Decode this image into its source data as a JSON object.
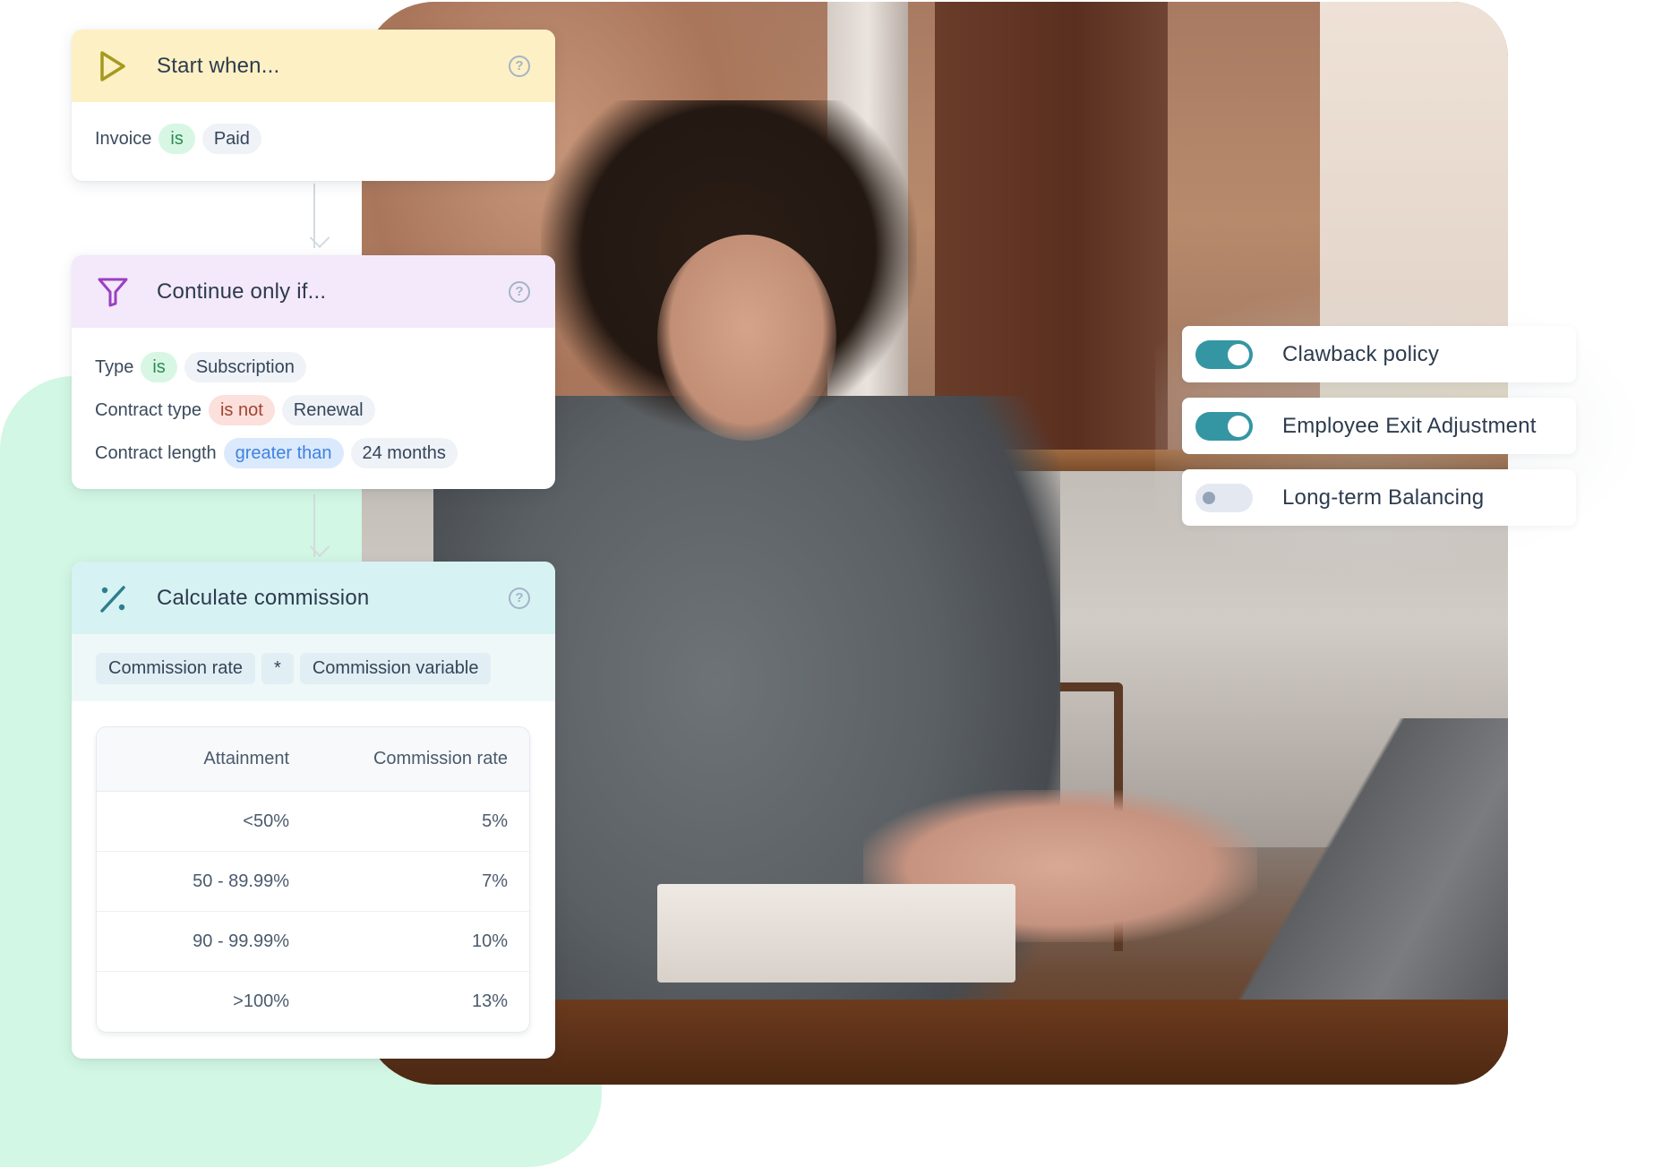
{
  "workflow": {
    "steps": [
      {
        "title": "Start when...",
        "icon": "play-icon",
        "help_icon": "question-circle-icon",
        "conditions": [
          {
            "field": "Invoice",
            "operator": "is",
            "value": "Paid"
          }
        ]
      },
      {
        "title": "Continue only if...",
        "icon": "filter-icon",
        "help_icon": "question-circle-icon",
        "conditions": [
          {
            "field": "Type",
            "operator": "is",
            "value": "Subscription"
          },
          {
            "field": "Contract type",
            "operator": "is not",
            "value": "Renewal"
          },
          {
            "field": "Contract length",
            "operator": "greater than",
            "value": "24 months"
          }
        ]
      },
      {
        "title": "Calculate commission",
        "icon": "percent-icon",
        "help_icon": "question-circle-icon",
        "formula": [
          "Commission rate",
          "*",
          "Commission variable"
        ],
        "table": {
          "headers": [
            "Attainment",
            "Commission rate"
          ],
          "rows": [
            [
              "<50%",
              "5%"
            ],
            [
              "50 - 89.99%",
              "7%"
            ],
            [
              "90 - 99.99%",
              "10%"
            ],
            [
              ">100%",
              "13%"
            ]
          ]
        }
      }
    ],
    "help_glyph": "?"
  },
  "toggles": [
    {
      "label": "Clawback policy",
      "enabled": true
    },
    {
      "label": "Employee Exit Adjustment",
      "enabled": true
    },
    {
      "label": "Long-term Balancing",
      "enabled": false
    }
  ],
  "colors": {
    "toggle_on": "#3596a3",
    "toggle_off": "#e4e9f1",
    "start_header": "#fdf0c4",
    "filter_header": "#f4e8fb",
    "calc_header": "#d7f2f3",
    "background_blob": "#d2f7e4",
    "play_icon": "#a59a1f",
    "filter_icon": "#9b3fc2",
    "percent_icon": "#2f7d8e"
  },
  "photo": {
    "description": "Woman with curly hair and glasses typing on a laptop in a cafe"
  }
}
